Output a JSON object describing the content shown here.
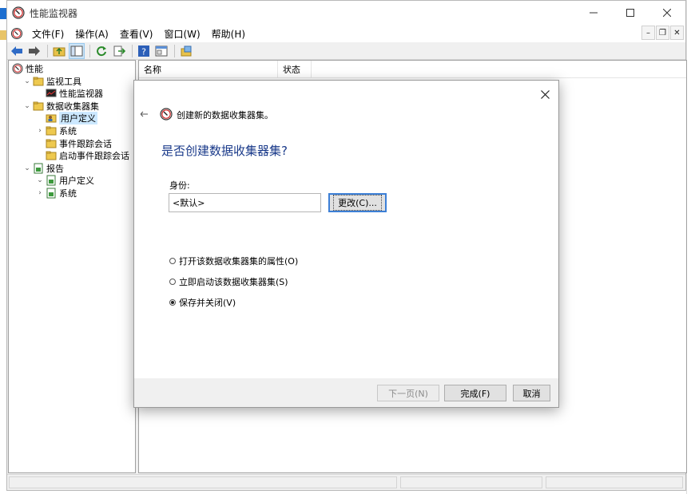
{
  "window": {
    "title": "性能监视器"
  },
  "menu": [
    "文件(F)",
    "操作(A)",
    "查看(V)",
    "窗口(W)",
    "帮助(H)"
  ],
  "tree": [
    {
      "label": "性能",
      "level": 0,
      "chev": "",
      "icon": "perf-icon"
    },
    {
      "label": "监视工具",
      "level": 1,
      "chev": "⌄",
      "icon": "folder-icon"
    },
    {
      "label": "性能监视器",
      "level": 2,
      "chev": "",
      "icon": "monitor-icon"
    },
    {
      "label": "数据收集器集",
      "level": 1,
      "chev": "⌄",
      "icon": "folder-icon"
    },
    {
      "label": "用户定义",
      "level": 2,
      "chev": "",
      "icon": "user-folder-icon",
      "selected": true
    },
    {
      "label": "系统",
      "level": 2,
      "chev": "›",
      "icon": "folder-icon"
    },
    {
      "label": "事件跟踪会话",
      "level": 2,
      "chev": "",
      "icon": "folder-icon"
    },
    {
      "label": "启动事件跟踪会话",
      "level": 2,
      "chev": "",
      "icon": "folder-icon"
    },
    {
      "label": "报告",
      "level": 1,
      "chev": "⌄",
      "icon": "report-icon"
    },
    {
      "label": "用户定义",
      "level": 2,
      "chev": "⌄",
      "icon": "report-icon"
    },
    {
      "label": "系统",
      "level": 2,
      "chev": "›",
      "icon": "report-icon"
    }
  ],
  "list": {
    "columns": [
      "名称",
      "状态"
    ]
  },
  "dialog": {
    "wizard_title": "创建新的数据收集器集。",
    "heading": "是否创建数据收集器集?",
    "identity_label": "身份:",
    "identity_value": "<默认>",
    "change_button": "更改(C)...",
    "options": [
      {
        "label": "打开该数据收集器集的属性(O)",
        "checked": false
      },
      {
        "label": "立即启动该数据收集器集(S)",
        "checked": false
      },
      {
        "label": "保存并关闭(V)",
        "checked": true
      }
    ],
    "buttons": {
      "next": "下一页(N)",
      "finish": "完成(F)",
      "cancel": "取消"
    }
  },
  "colors": {
    "accent": "#3c7fd6",
    "heading": "#1a3a8a",
    "selection": "#cce8ff"
  }
}
